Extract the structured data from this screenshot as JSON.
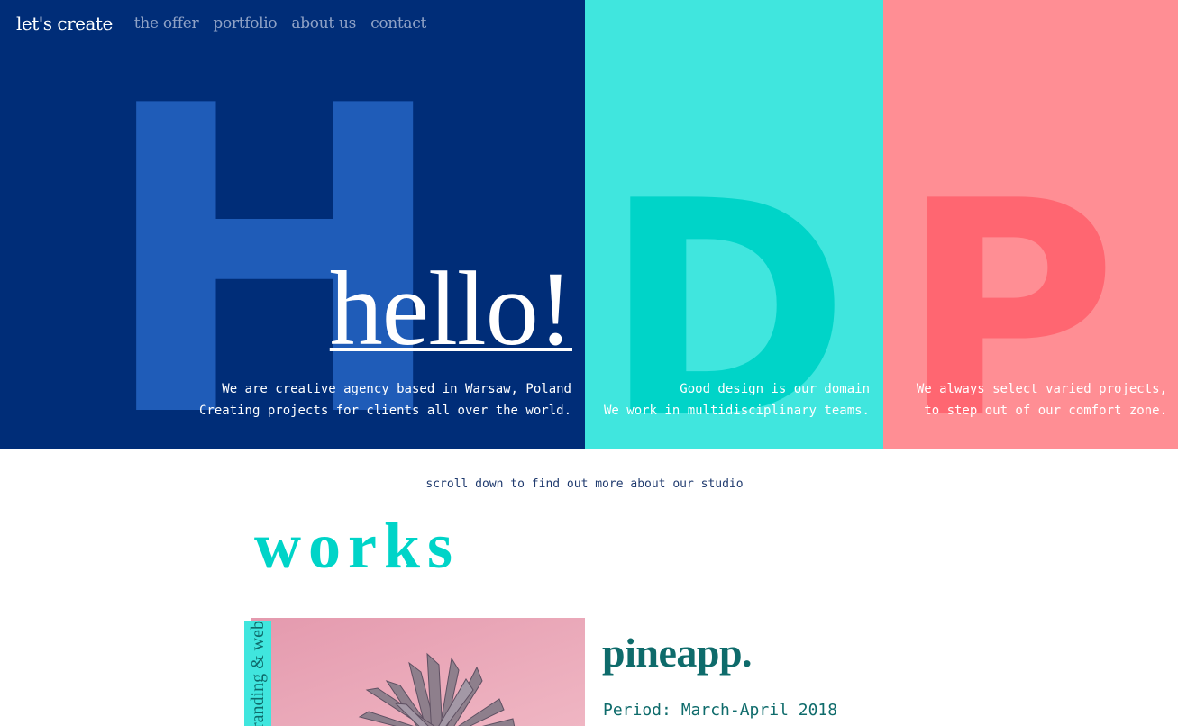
{
  "nav": {
    "brand": "let's create",
    "links": [
      "the offer",
      "portfolio",
      "about us",
      "contact"
    ]
  },
  "hero": {
    "panels": [
      {
        "letter": "H",
        "color": "#002d78",
        "letter_color": "#1f5cb8",
        "lines": [
          "We are creative agency based in Warsaw, Poland",
          "Creating projects for clients all over the world."
        ]
      },
      {
        "letter": "D",
        "color": "#40e6de",
        "letter_color": "#00d4c8",
        "lines": [
          "Good design is our domain",
          "We work in multidisciplinary teams."
        ]
      },
      {
        "letter": "P",
        "color": "#ff8e94",
        "letter_color": "#ff6671",
        "lines": [
          "We always select varied projects,",
          "to step out of our comfort zone."
        ]
      }
    ],
    "hello": "hello!"
  },
  "scroll_note": "scroll down to find out more about our studio",
  "works": {
    "title": "works",
    "items": [
      {
        "category": "branding & web",
        "title": "pineapp.",
        "period": "Period: March-April 2018"
      }
    ]
  },
  "colors": {
    "accent": "#00d4c8",
    "dark_teal": "#0e6b6b",
    "navy": "#002d78"
  }
}
